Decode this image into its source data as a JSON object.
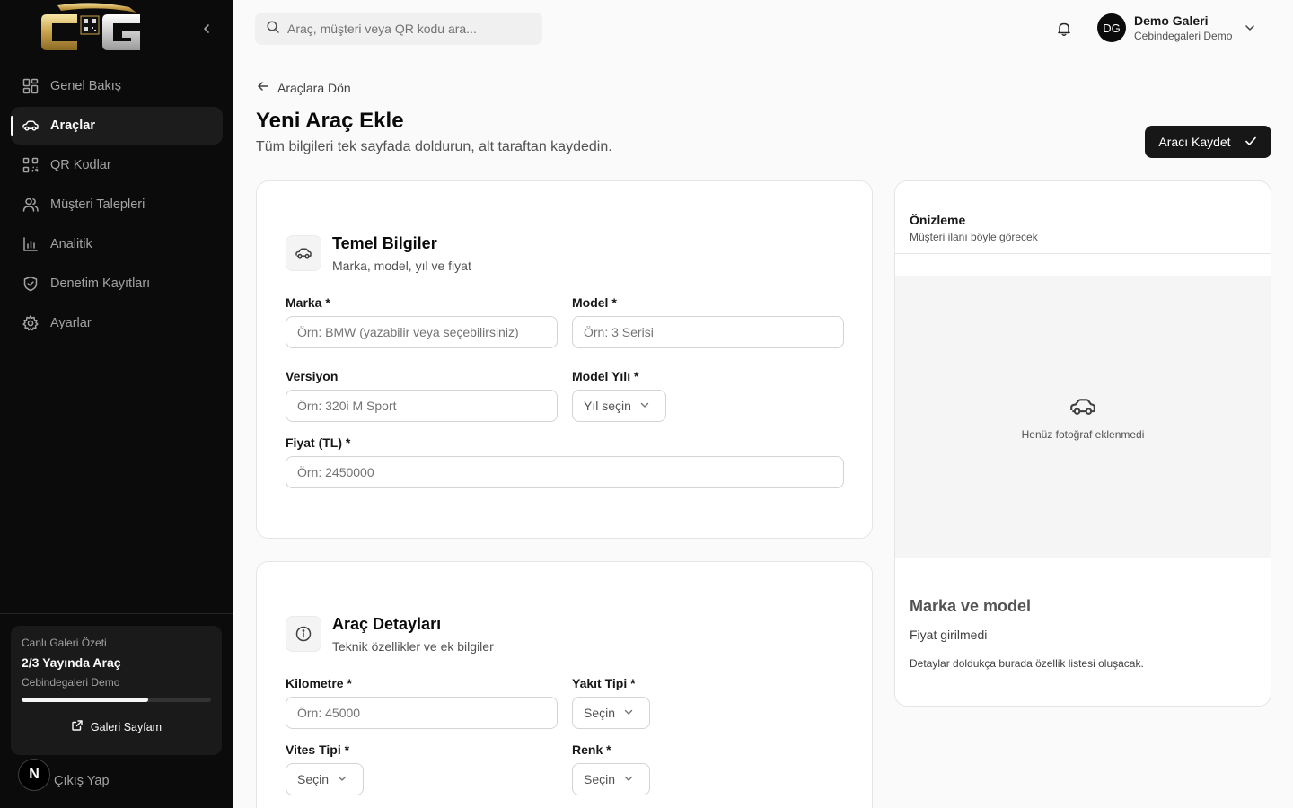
{
  "sidebar": {
    "nav": [
      {
        "label": "Genel Bakış",
        "icon": "dashboard-icon"
      },
      {
        "label": "Araçlar",
        "icon": "car-icon",
        "active": true
      },
      {
        "label": "QR Kodlar",
        "icon": "qr-code-icon"
      },
      {
        "label": "Müşteri Talepleri",
        "icon": "users-icon"
      },
      {
        "label": "Analitik",
        "icon": "bar-chart-icon"
      },
      {
        "label": "Denetim Kayıtları",
        "icon": "shield-check-icon"
      },
      {
        "label": "Ayarlar",
        "icon": "gear-icon"
      }
    ],
    "summary": {
      "caption": "Canlı Galeri Özeti",
      "main": "2/3 Yayında Araç",
      "sub": "Cebindegaleri Demo",
      "progress": 0.667,
      "link": "Galeri Sayfam"
    },
    "logout": "Çıkış Yap",
    "badge": "N"
  },
  "topbar": {
    "search_placeholder": "Araç, müşteri veya QR kodu ara...",
    "avatar": "DG",
    "user_name": "Demo Galeri",
    "user_org": "Cebindegaleri Demo"
  },
  "page": {
    "back": "Araçlara Dön",
    "title": "Yeni Araç Ekle",
    "subtitle": "Tüm bilgileri tek sayfada doldurun, alt taraftan kaydedin.",
    "save": "Aracı Kaydet"
  },
  "basic": {
    "title": "Temel Bilgiler",
    "subtitle": "Marka, model, yıl ve fiyat",
    "brand_label": "Marka *",
    "brand_ph": "Örn: BMW (yazabilir veya seçebilirsiniz)",
    "model_label": "Model *",
    "model_ph": "Örn: 3 Serisi",
    "version_label": "Versiyon",
    "version_ph": "Örn: 320i M Sport",
    "year_label": "Model Yılı *",
    "year_value": "Yıl seçin",
    "price_label": "Fiyat (TL) *",
    "price_ph": "Örn: 2450000"
  },
  "details": {
    "title": "Araç Detayları",
    "subtitle": "Teknik özellikler ve ek bilgiler",
    "km_label": "Kilometre *",
    "km_ph": "Örn: 45000",
    "fuel_label": "Yakıt Tipi *",
    "fuel_value": "Seçin",
    "gear_label": "Vites Tipi *",
    "gear_value": "Seçin",
    "color_label": "Renk *",
    "color_value": "Seçin"
  },
  "preview": {
    "title": "Önizleme",
    "subtitle": "Müşteri ilanı böyle görecek",
    "no_photo": "Henüz fotoğraf eklenmedi",
    "brand": "Marka ve model",
    "price": "Fiyat girilmedi",
    "details": "Detaylar doldukça burada özellik listesi oluşacak."
  }
}
